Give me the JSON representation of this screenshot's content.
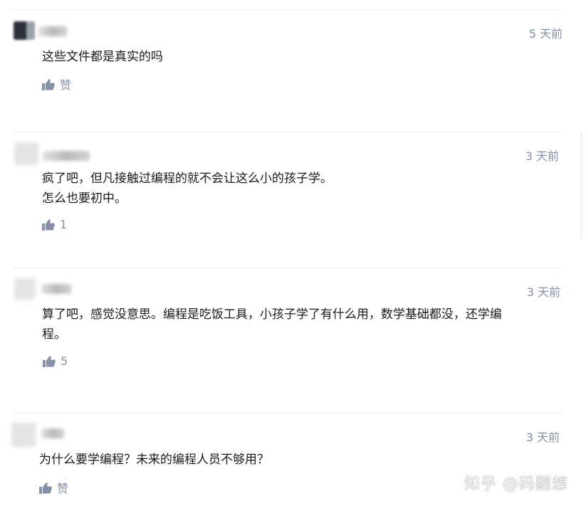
{
  "comments": [
    {
      "time": "5 天前",
      "lines": [
        "这些文件都是真实的吗"
      ],
      "like_label": "赞"
    },
    {
      "time": "3 天前",
      "lines": [
        "疯了吧，但凡接触过编程的就不会让这么小的孩子学。",
        "怎么也要初中。"
      ],
      "like_label": "1"
    },
    {
      "time": "3 天前",
      "lines": [
        "算了吧，感觉没意思。编程是吃饭工具，小孩子学了有什么用，数学基础都没，还学编",
        "程。"
      ],
      "like_label": "5"
    },
    {
      "time": "3 天前",
      "lines": [
        "为什么要学编程？未来的编程人员不够用？"
      ],
      "like_label": "赞"
    }
  ],
  "watermark": "知乎 @码翻想"
}
